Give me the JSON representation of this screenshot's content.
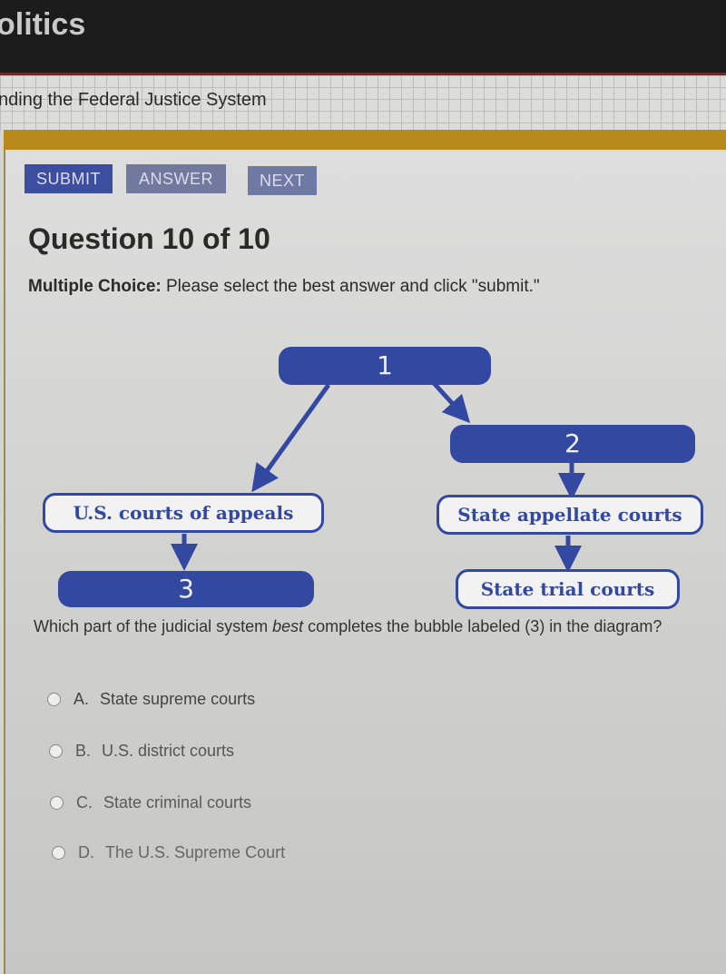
{
  "header": {
    "course_title": "olitics",
    "lesson_title": "nding the Federal Justice System"
  },
  "toolbar": {
    "submit_label": "SUBMIT",
    "answer_label": "ANSWER",
    "next_label": "NEXT"
  },
  "question": {
    "title": "Question 10 of 10",
    "type_label": "Multiple Choice:",
    "instructions": " Please select the best answer and click \"submit.\"",
    "prompt_before": "Which part of the judicial system ",
    "prompt_emphasis": "best",
    "prompt_after": " completes the bubble labeled (3) in the diagram?",
    "options": [
      {
        "letter": "A.",
        "text": "State supreme courts"
      },
      {
        "letter": "B.",
        "text": "U.S. district courts"
      },
      {
        "letter": "C.",
        "text": "State criminal courts"
      },
      {
        "letter": "D.",
        "text": "The U.S. Supreme Court"
      }
    ]
  },
  "diagram": {
    "box1": "1",
    "box2": "2",
    "box3": "3",
    "federal_appeals": "U.S. courts of appeals",
    "state_appellate": "State appellate courts",
    "state_trial": "State trial courts",
    "accent_color": "#3348a0"
  }
}
